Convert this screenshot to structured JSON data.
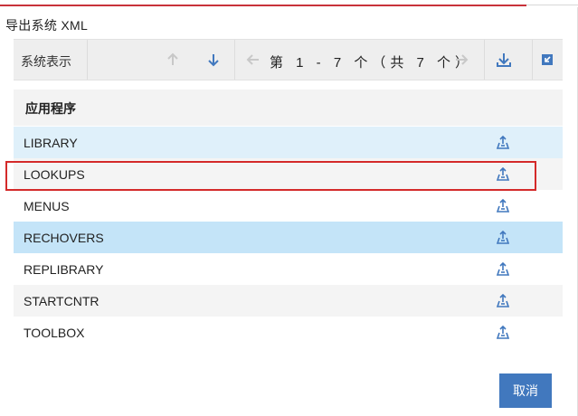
{
  "dialog": {
    "title": "导出系统 XML",
    "cancel_label": "取消"
  },
  "toolbar": {
    "title": "系统表示",
    "pager_text": "第 1 - 7 个（共 7 个）",
    "icons": {
      "move_up": "arrow-up-icon",
      "move_down": "arrow-down-icon",
      "prev_page": "arrow-left-icon",
      "next_page": "arrow-right-icon",
      "download": "download-icon",
      "collapse": "collapse-icon"
    }
  },
  "table": {
    "column_header": "应用程序",
    "rows": [
      {
        "label": "LIBRARY",
        "selected": true
      },
      {
        "label": "LOOKUPS",
        "selected": false
      },
      {
        "label": "MENUS",
        "selected": false
      },
      {
        "label": "RECHOVERS",
        "selected": true
      },
      {
        "label": "REPLIBRARY",
        "selected": false
      },
      {
        "label": "STARTCNTR",
        "selected": false
      },
      {
        "label": "TOOLBOX",
        "selected": false
      }
    ],
    "row_action_icon": "export-icon"
  },
  "colors": {
    "accent": "#4178be",
    "selected_row": "#dff0fa",
    "selected_row_strong": "#c4e4f8",
    "alt_row": "#f4f4f4",
    "disabled_icon": "#c8c8c8",
    "highlight": "#d42a2a"
  }
}
